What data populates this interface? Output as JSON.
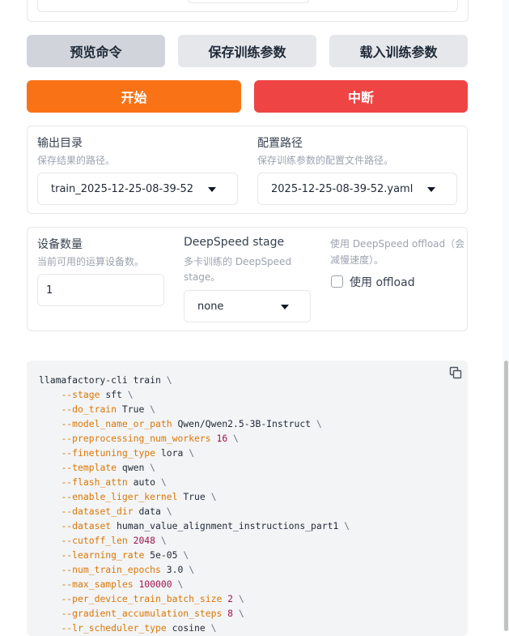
{
  "buttons": {
    "preview": "预览命令",
    "save": "保存训练参数",
    "load": "载入训练参数",
    "start": "开始",
    "abort": "中断"
  },
  "output_panel": {
    "output_dir": {
      "label": "输出目录",
      "info": "保存结果的路径。",
      "value": "train_2025-12-25-08-39-52"
    },
    "config_path": {
      "label": "配置路径",
      "info": "保存训练参数的配置文件路径。",
      "value": "2025-12-25-08-39-52.yaml"
    }
  },
  "device_panel": {
    "device_count": {
      "label": "设备数量",
      "info": "当前可用的运算设备数。",
      "value": "1"
    },
    "ds_stage": {
      "label": "DeepSpeed stage",
      "info_line1": "多卡训练的 DeepSpeed",
      "info_line2": "stage。",
      "value": "none"
    },
    "ds_offload": {
      "info_line1": "使用 DeepSpeed offload（会",
      "info_line2": "减慢速度）。",
      "checkbox_label": "使用 offload",
      "checked": false
    }
  },
  "command": {
    "first_line": "llamafactory-cli train",
    "args": [
      {
        "flag": "--stage",
        "value": "sft",
        "is_num": false
      },
      {
        "flag": "--do_train",
        "value": "True",
        "is_num": false
      },
      {
        "flag": "--model_name_or_path",
        "value": "Qwen/Qwen2.5-3B-Instruct",
        "is_num": false
      },
      {
        "flag": "--preprocessing_num_workers",
        "value": "16",
        "is_num": true
      },
      {
        "flag": "--finetuning_type",
        "value": "lora",
        "is_num": false
      },
      {
        "flag": "--template",
        "value": "qwen",
        "is_num": false
      },
      {
        "flag": "--flash_attn",
        "value": "auto",
        "is_num": false
      },
      {
        "flag": "--enable_liger_kernel",
        "value": "True",
        "is_num": false
      },
      {
        "flag": "--dataset_dir",
        "value": "data",
        "is_num": false
      },
      {
        "flag": "--dataset",
        "value": "human_value_alignment_instructions_part1",
        "is_num": false
      },
      {
        "flag": "--cutoff_len",
        "value": "2048",
        "is_num": true
      },
      {
        "flag": "--learning_rate",
        "value": "5e-05",
        "is_num": false
      },
      {
        "flag": "--num_train_epochs",
        "value": "3.0",
        "is_num": false
      },
      {
        "flag": "--max_samples",
        "value": "100000",
        "is_num": true
      },
      {
        "flag": "--per_device_train_batch_size",
        "value": "2",
        "is_num": true
      },
      {
        "flag": "--gradient_accumulation_steps",
        "value": "8",
        "is_num": true
      },
      {
        "flag": "--lr_scheduler_type",
        "value": "cosine",
        "is_num": false
      }
    ]
  },
  "colors": {
    "start": "#f97316",
    "abort": "#ef4444",
    "flag": "#d97706",
    "number": "#9d174d"
  }
}
